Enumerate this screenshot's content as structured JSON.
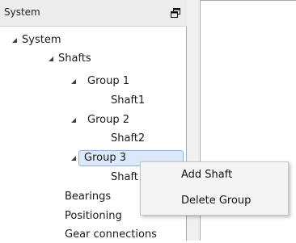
{
  "panel": {
    "title": "System",
    "restore_icon": "window-restore-icon"
  },
  "tree": {
    "items": [
      {
        "label": "System",
        "expanded": true
      },
      {
        "label": "Shafts",
        "expanded": true
      },
      {
        "label": "Group 1",
        "expanded": true
      },
      {
        "label": "Shaft1"
      },
      {
        "label": "Group 2",
        "expanded": true
      },
      {
        "label": "Shaft2"
      },
      {
        "label": "Group 3",
        "expanded": true,
        "selected": true
      },
      {
        "label": "Shaft"
      },
      {
        "label": "Bearings"
      },
      {
        "label": "Positioning"
      },
      {
        "label": "Gear connections"
      }
    ],
    "expand_icon": "expanded-triangle-icon"
  },
  "context_menu": {
    "items": [
      {
        "label": "Add Shaft"
      },
      {
        "label": "Delete Group"
      }
    ]
  },
  "colors": {
    "selection_bg": "#dce9fb",
    "selection_border": "#8ab1e6",
    "menu_bg": "#f5f5f5"
  }
}
